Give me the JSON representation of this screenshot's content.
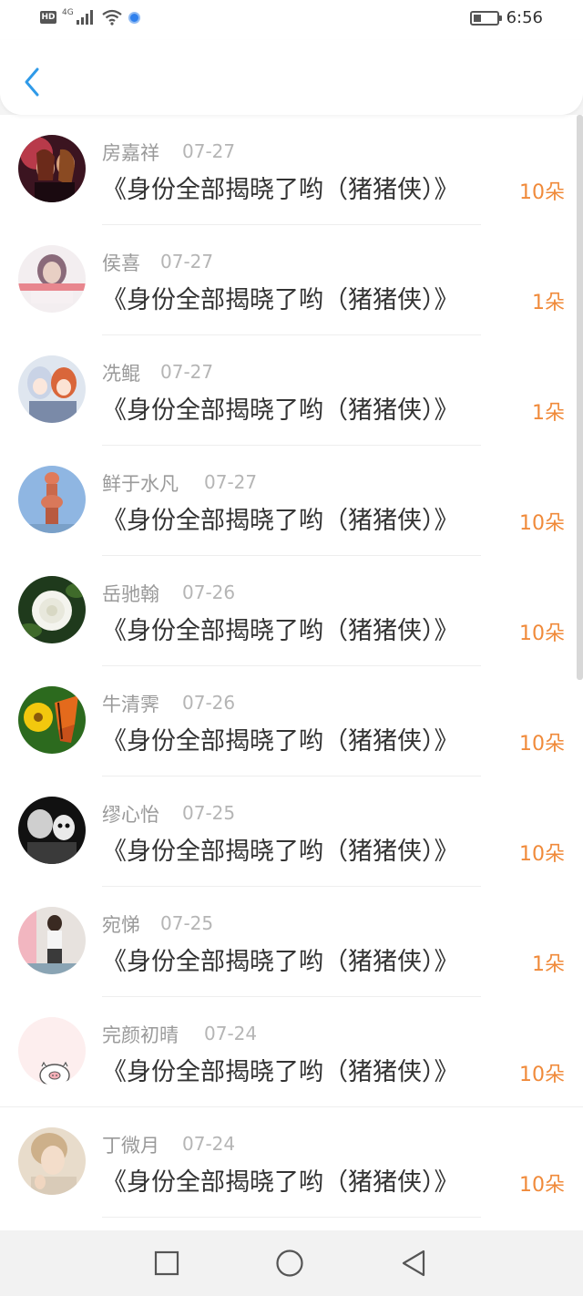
{
  "status_bar": {
    "hd_label": "HD",
    "network_label": "4G",
    "time": "6:56"
  },
  "nav": {
    "back_icon": "chevron-left-icon",
    "accent_color": "#2f9ae8"
  },
  "colors": {
    "amount": "#f08a3a",
    "name": "#9a9a9a",
    "date": "#b5b5b5",
    "title": "#333333"
  },
  "list": {
    "items": [
      {
        "name": "房嘉祥",
        "date": "07-27",
        "title": "《身份全部揭晓了哟（猪猪侠）》",
        "amount": "10朵",
        "avatar": "avatar-photo-group"
      },
      {
        "name": "侯喜",
        "date": "07-27",
        "title": "《身份全部揭晓了哟（猪猪侠）》",
        "amount": "1朵",
        "avatar": "avatar-photo-portrait"
      },
      {
        "name": "冼鲲",
        "date": "07-27",
        "title": "《身份全部揭晓了哟（猪猪侠）》",
        "amount": "1朵",
        "avatar": "avatar-anime"
      },
      {
        "name": "鲜于水凡",
        "date": "07-27",
        "title": "《身份全部揭晓了哟（猪猪侠）》",
        "amount": "10朵",
        "avatar": "avatar-statue"
      },
      {
        "name": "岳驰翰",
        "date": "07-26",
        "title": "《身份全部揭晓了哟（猪猪侠）》",
        "amount": "10朵",
        "avatar": "avatar-flower"
      },
      {
        "name": "牛清霁",
        "date": "07-26",
        "title": "《身份全部揭晓了哟（猪猪侠）》",
        "amount": "10朵",
        "avatar": "avatar-butterfly"
      },
      {
        "name": "缪心怡",
        "date": "07-25",
        "title": "《身份全部揭晓了哟（猪猪侠）》",
        "amount": "10朵",
        "avatar": "avatar-bw-photo"
      },
      {
        "name": "宛悌",
        "date": "07-25",
        "title": "《身份全部揭晓了哟（猪猪侠）》",
        "amount": "1朵",
        "avatar": "avatar-girl-photo"
      },
      {
        "name": "完颜初晴",
        "date": "07-24",
        "title": "《身份全部揭晓了哟（猪猪侠）》",
        "amount": "10朵",
        "avatar": "avatar-pig-cartoon"
      },
      {
        "name": "丁微月",
        "date": "07-24",
        "title": "《身份全部揭晓了哟（猪猪侠）》",
        "amount": "10朵",
        "avatar": "avatar-portrait-light"
      }
    ]
  },
  "system_nav": {
    "recent_icon": "square-icon",
    "home_icon": "circle-icon",
    "back_icon": "triangle-back-icon"
  }
}
